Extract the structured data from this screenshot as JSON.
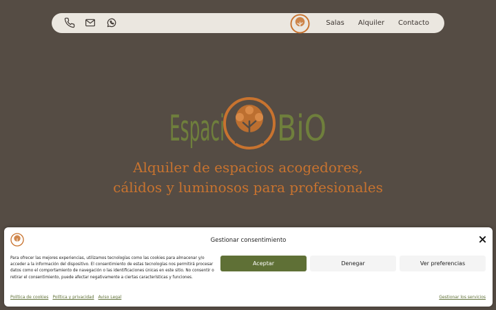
{
  "nav": {
    "icons": [
      "phone-icon",
      "mail-icon",
      "whatsapp-icon"
    ],
    "menu": [
      "Salas",
      "Alquiler",
      "Contacto"
    ]
  },
  "hero": {
    "brand_left": "Espaci",
    "brand_right": "BiO",
    "tagline_line1": "Alquiler de espacios acogedores,",
    "tagline_line2": "cálidos y luminosos para profesionales"
  },
  "consent": {
    "title": "Gestionar consentimiento",
    "text": "Para ofrecer las mejores experiencias, utilizamos tecnologías como las cookies para almacenar y/o acceder a la información del dispositivo. El consentimiento de estas tecnologías nos permitirá procesar datos como el comportamiento de navegación o las identificaciones únicas en este sitio. No consentir o retirar el consentimiento, puede afectar negativamente a ciertas características y funciones.",
    "accept": "Aceptar",
    "deny": "Denegar",
    "preferences": "Ver preferencias",
    "links": [
      "Política de cookies",
      "Política y privacidad",
      "Aviso Legal"
    ],
    "manage": "Gestionar los servicios"
  },
  "colors": {
    "background": "#554c44",
    "brand_green": "#6f7f3c",
    "brand_orange": "#c8732f",
    "accept_green": "#5f7036"
  }
}
